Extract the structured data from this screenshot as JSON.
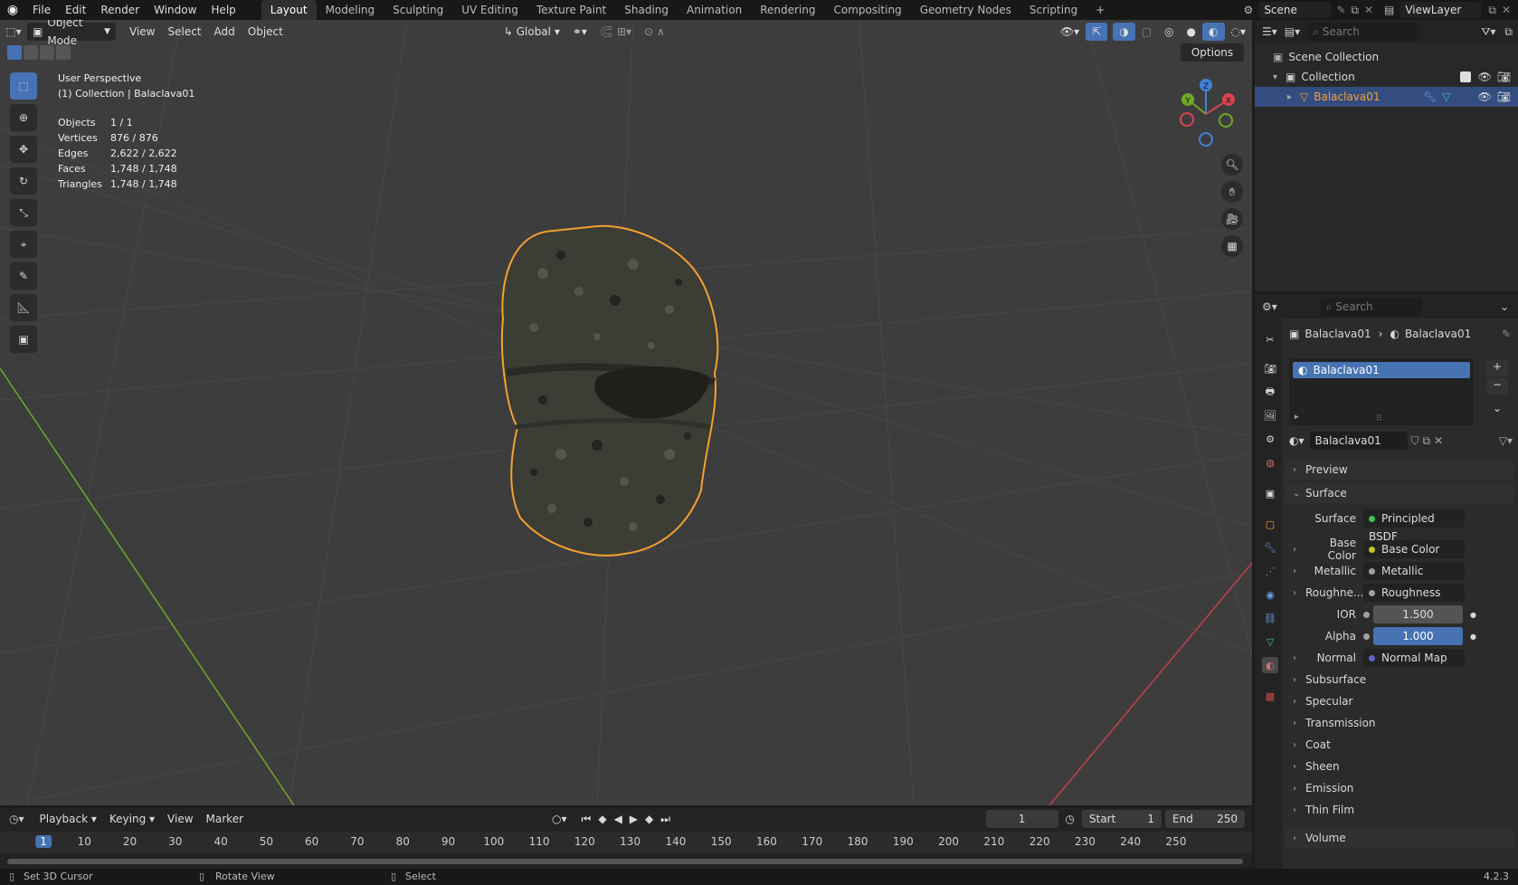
{
  "menubar": {
    "items": [
      "File",
      "Edit",
      "Render",
      "Window",
      "Help"
    ],
    "workspaces": [
      "Layout",
      "Modeling",
      "Sculpting",
      "UV Editing",
      "Texture Paint",
      "Shading",
      "Animation",
      "Rendering",
      "Compositing",
      "Geometry Nodes",
      "Scripting"
    ],
    "active_workspace": "Layout",
    "add_workspace": "+",
    "scene_label": "Scene",
    "view_layer_label": "ViewLayer"
  },
  "viewport_header": {
    "mode": "Object Mode",
    "menus": [
      "View",
      "Select",
      "Add",
      "Object"
    ],
    "orientation": "Global",
    "options_label": "Options"
  },
  "overlay_text": {
    "perspective": "User Perspective",
    "collection": "(1) Collection | Balaclava01",
    "stats": [
      {
        "label": "Objects",
        "value": "1 / 1"
      },
      {
        "label": "Vertices",
        "value": "876 / 876"
      },
      {
        "label": "Edges",
        "value": "2,622 / 2,622"
      },
      {
        "label": "Faces",
        "value": "1,748 / 1,748"
      },
      {
        "label": "Triangles",
        "value": "1,748 / 1,748"
      }
    ]
  },
  "gizmo": {
    "x": "X",
    "y": "Y",
    "z": "Z"
  },
  "outliner": {
    "search_placeholder": "Search",
    "scene_collection": "Scene Collection",
    "collection": "Collection",
    "object": "Balaclava01"
  },
  "properties": {
    "search_placeholder": "Search",
    "breadcrumb_object": "Balaclava01",
    "breadcrumb_material": "Balaclava01",
    "slot_name": "Balaclava01",
    "material_name": "Balaclava01",
    "preview": "Preview",
    "surface_panel": "Surface",
    "surface_label": "Surface",
    "surface_value": "Principled BSDF",
    "inputs": [
      {
        "label": "Base Color",
        "value": "Base Color",
        "dot": "#c7c729",
        "expand": true
      },
      {
        "label": "Metallic",
        "value": "Metallic",
        "dot": "#a1a1a1",
        "expand": true
      },
      {
        "label": "Roughne...",
        "value": "Roughness",
        "dot": "#a1a1a1",
        "expand": true
      },
      {
        "label": "IOR",
        "value": "1.500",
        "dot": "#a1a1a1",
        "expand": false,
        "numeric": true
      },
      {
        "label": "Alpha",
        "value": "1.000",
        "dot": "#a1a1a1",
        "expand": false,
        "numeric": true,
        "highlight": true
      },
      {
        "label": "Normal",
        "value": "Normal Map",
        "dot": "#6363c7",
        "expand": true
      }
    ],
    "subpanels": [
      "Subsurface",
      "Specular",
      "Transmission",
      "Coat",
      "Sheen",
      "Emission",
      "Thin Film"
    ],
    "volume": "Volume"
  },
  "timeline": {
    "menus": [
      "Playback",
      "Keying",
      "View",
      "Marker"
    ],
    "current_frame": "1",
    "start_label": "Start",
    "start_value": "1",
    "end_label": "End",
    "end_value": "250",
    "ticks": [
      "1",
      "10",
      "20",
      "30",
      "40",
      "50",
      "60",
      "70",
      "80",
      "90",
      "100",
      "110",
      "120",
      "130",
      "140",
      "150",
      "160",
      "170",
      "180",
      "190",
      "200",
      "210",
      "220",
      "230",
      "240",
      "250"
    ]
  },
  "statusbar": {
    "left": "Set 3D Cursor",
    "middle": "Rotate View",
    "right": "Select",
    "version": "4.2.3"
  },
  "colors": {
    "accent": "#4772b3",
    "selection_outline": "#f5a031",
    "x_axis": "#d84452",
    "y_axis": "#6ea72c",
    "z_axis": "#3f82d7"
  }
}
